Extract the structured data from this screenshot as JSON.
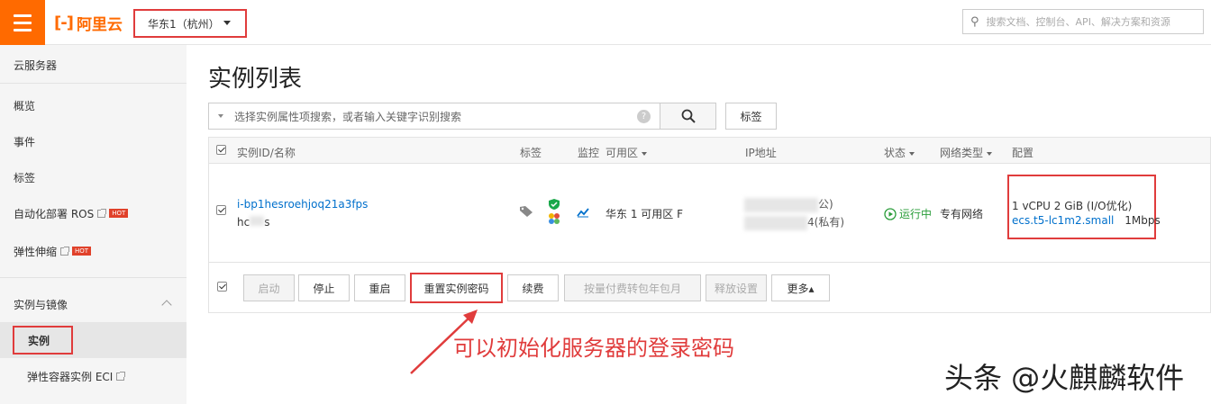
{
  "header": {
    "brand": "阿里云",
    "region": "华东1（杭州）",
    "search_placeholder": "搜索文档、控制台、API、解决方案和资源"
  },
  "sidebar": {
    "title": "云服务器",
    "items": [
      {
        "label": "概览"
      },
      {
        "label": "事件"
      },
      {
        "label": "标签"
      },
      {
        "label": "自动化部署 ROS",
        "badge": "HOT"
      },
      {
        "label": "弹性伸缩",
        "badge": "HOT"
      }
    ],
    "section": "实例与镜像",
    "active_item": "实例",
    "sub_item": "弹性容器实例 ECI"
  },
  "main": {
    "title": "实例列表",
    "filter_placeholder": "选择实例属性项搜索，或者输入关键字识别搜索",
    "tag_button": "标签",
    "columns": {
      "id_name": "实例ID/名称",
      "tags": "标签",
      "monitor": "监控",
      "zone": "可用区",
      "ip": "IP地址",
      "status": "状态",
      "network": "网络类型",
      "config": "配置"
    },
    "row": {
      "instance_id": "i-bp1hesroehjoq21a3fps",
      "name_prefix": "hc",
      "name_suffix": "s",
      "zone": "华东 1 可用区 F",
      "ip_public_suffix": "公)",
      "ip_private_suffix": "4(私有)",
      "status": "运行中",
      "network": "专有网络",
      "config_line1": "1 vCPU 2 GiB (I/O优化)",
      "instance_type": "ecs.t5-lc1m2.small",
      "bandwidth": "1Mbps"
    },
    "actions": {
      "start": "启动",
      "stop": "停止",
      "restart": "重启",
      "reset_password": "重置实例密码",
      "renew": "续费",
      "convert": "按量付费转包年包月",
      "release": "释放设置",
      "more": "更多▴"
    }
  },
  "annotation": "可以初始化服务器的登录密码",
  "watermark": "头条 @火麒麟软件",
  "colors": {
    "accent": "#ff6a00",
    "highlight": "#e03c3c",
    "link": "#0070cc",
    "running": "#2a9d3a"
  }
}
